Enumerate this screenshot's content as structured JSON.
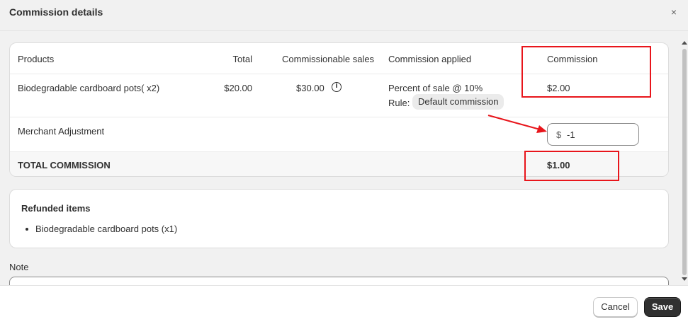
{
  "dialog": {
    "title": "Commission details",
    "close_icon": "×"
  },
  "table": {
    "headers": {
      "products": "Products",
      "total": "Total",
      "commissionable_sales": "Commissionable sales",
      "commission_applied": "Commission applied",
      "commission": "Commission"
    },
    "row": {
      "product": "Biodegradable cardboard pots( x2)",
      "total": "$20.00",
      "commissionable_sales": "$30.00",
      "info_icon": "i",
      "commission_applied": "Percent of sale @ 10%",
      "rule_label": "Rule:",
      "rule_badge": "Default commission",
      "commission": "$2.00"
    },
    "adjustment": {
      "label": "Merchant Adjustment",
      "prefix": "$",
      "value": "-1"
    },
    "total": {
      "label": "TOTAL COMMISSION",
      "value": "$1.00"
    }
  },
  "refunded": {
    "title": "Refunded items",
    "items": [
      "Biodegradable cardboard pots (x1)"
    ]
  },
  "note": {
    "label": "Note"
  },
  "footer": {
    "cancel_label": "Cancel",
    "save_label": "Save"
  },
  "colors": {
    "annotation": "#e8151b",
    "primary_button": "#303030",
    "background": "#f1f1f1"
  }
}
